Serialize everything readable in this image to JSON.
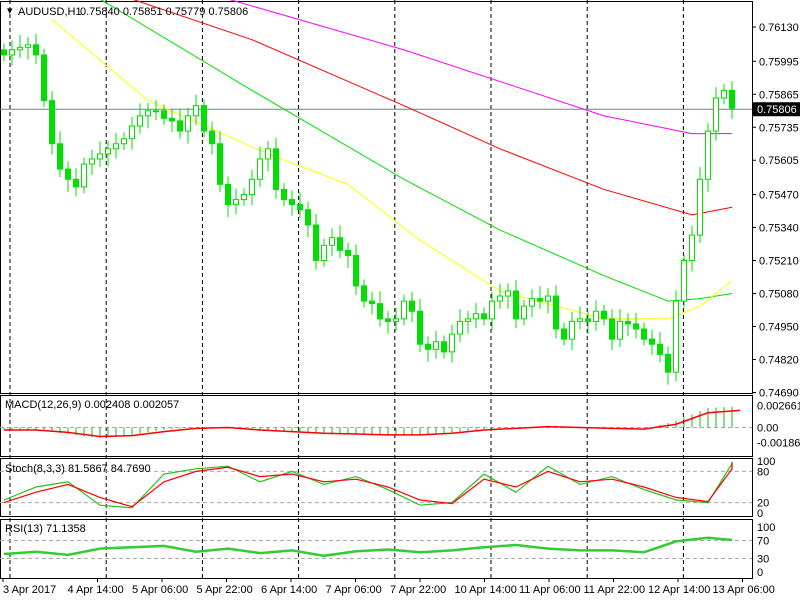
{
  "header": {
    "symbol": "AUDUSD,H1",
    "ohlc_text": "0.75840 0.75851 0.75779 0.75806"
  },
  "colors": {
    "bull": "#00e000",
    "bear": "#00e000",
    "ma1": "#ff00ff",
    "ma2": "#ff0000",
    "ma3": "#00e000",
    "ma4": "#ffff00",
    "grid": "#000000",
    "current": "#708090"
  },
  "chart_data": [
    {
      "type": "candlestick",
      "title": "AUDUSD,H1",
      "price_axis_ticks": [
        "0.76130",
        "0.75995",
        "0.75865",
        "0.75735",
        "0.75605",
        "0.75470",
        "0.75340",
        "0.75210",
        "0.75080",
        "0.74950",
        "0.74820",
        "0.74690"
      ],
      "ylim": [
        0.7469,
        0.7613
      ],
      "current_price": "0.75806",
      "closes": [
        0.7602,
        0.7604,
        0.7605,
        0.7606,
        0.7602,
        0.7584,
        0.7567,
        0.7557,
        0.7553,
        0.755,
        0.7559,
        0.7561,
        0.7563,
        0.7565,
        0.7567,
        0.7569,
        0.7574,
        0.7578,
        0.758,
        0.758,
        0.7577,
        0.7576,
        0.7572,
        0.7578,
        0.7582,
        0.7572,
        0.7567,
        0.7551,
        0.7543,
        0.7545,
        0.7547,
        0.7553,
        0.7561,
        0.7565,
        0.7549,
        0.7545,
        0.7543,
        0.7541,
        0.7535,
        0.7521,
        0.7527,
        0.753,
        0.7525,
        0.7523,
        0.7511,
        0.7505,
        0.7504,
        0.7498,
        0.7497,
        0.7498,
        0.7505,
        0.7501,
        0.7488,
        0.7486,
        0.7489,
        0.7485,
        0.7492,
        0.7497,
        0.7498,
        0.75,
        0.7498,
        0.7505,
        0.7507,
        0.7509,
        0.7498,
        0.7503,
        0.7506,
        0.7505,
        0.7507,
        0.7494,
        0.749,
        0.7497,
        0.7498,
        0.7497,
        0.7501,
        0.7498,
        0.749,
        0.7497,
        0.7496,
        0.7494,
        0.749,
        0.7488,
        0.7484,
        0.7477,
        0.7505,
        0.7521,
        0.7531,
        0.7553,
        0.7572,
        0.7585,
        0.7588,
        0.7581
      ],
      "moving_averages": [
        {
          "color": "#ff00ff",
          "points": [
            [
              28,
              0.7624
            ],
            [
              50,
              0.7604
            ],
            [
              75,
              0.7578
            ],
            [
              86,
              0.7571
            ],
            [
              91,
              0.7571
            ]
          ]
        },
        {
          "color": "#ff0000",
          "points": [
            [
              16,
              0.7624
            ],
            [
              31,
              0.7608
            ],
            [
              50,
              0.7582
            ],
            [
              62,
              0.7565
            ],
            [
              75,
              0.7549
            ],
            [
              86,
              0.7539
            ],
            [
              91,
              0.7542
            ]
          ]
        },
        {
          "color": "#00e000",
          "points": [
            [
              12,
              0.7624
            ],
            [
              31,
              0.7588
            ],
            [
              50,
              0.7553
            ],
            [
              62,
              0.7533
            ],
            [
              75,
              0.7515
            ],
            [
              83,
              0.7505
            ],
            [
              87,
              0.7506
            ],
            [
              91,
              0.7508
            ]
          ]
        },
        {
          "color": "#ffff00",
          "points": [
            [
              6,
              0.7616
            ],
            [
              18,
              0.7584
            ],
            [
              33,
              0.7563
            ],
            [
              43,
              0.7551
            ],
            [
              52,
              0.7529
            ],
            [
              62,
              0.7509
            ],
            [
              75,
              0.7498
            ],
            [
              83,
              0.7498
            ],
            [
              87,
              0.7503
            ],
            [
              91,
              0.7513
            ]
          ]
        }
      ],
      "time_labels": [
        "3 Apr 2017",
        "4 Apr 14:00",
        "5 Apr 06:00",
        "5 Apr 22:00",
        "6 Apr 14:00",
        "7 Apr 06:00",
        "7 Apr 22:00",
        "10 Apr 14:00",
        "11 Apr 06:00",
        "11 Apr 22:00",
        "12 Apr 14:00",
        "13 Apr 06:00"
      ]
    },
    {
      "type": "bar",
      "title": "MACD(12,26,9) 0.002408 0.002057",
      "ticks": [
        "0.002661",
        "0.00",
        "-0.001862"
      ],
      "sample_step": 4,
      "histogram": [
        -0.0002,
        -0.0003,
        -0.0008,
        -0.0013,
        -0.0009,
        -0.0003,
        0.0,
        0.0,
        -0.0004,
        -0.0006,
        -0.0008,
        -0.0009,
        -0.001,
        -0.001,
        -0.0006,
        -0.0002,
        0.0,
        0.0001,
        -0.0001,
        -0.0001,
        -0.0002,
        0.0008,
        0.0024,
        0.0026
      ],
      "signal": [
        -0.0003,
        -0.0003,
        -0.0006,
        -0.0011,
        -0.001,
        -0.0005,
        -0.0001,
        0.0,
        -0.0003,
        -0.0005,
        -0.0007,
        -0.0008,
        -0.0009,
        -0.0009,
        -0.0007,
        -0.0003,
        -0.0001,
        0.0001,
        0.0,
        -0.0001,
        -0.0002,
        0.0004,
        0.0018,
        0.0021
      ]
    },
    {
      "type": "line",
      "title": "Stoch(8,3,3) 81.5867 84.7690",
      "ticks": [
        "100",
        "80",
        "20",
        "0"
      ],
      "sample_step": 4,
      "k": [
        25,
        50,
        60,
        15,
        10,
        75,
        85,
        90,
        60,
        80,
        55,
        70,
        45,
        15,
        20,
        75,
        40,
        90,
        55,
        70,
        45,
        25,
        20,
        95,
        98,
        82
      ],
      "d": [
        20,
        40,
        55,
        30,
        12,
        60,
        80,
        88,
        70,
        75,
        60,
        65,
        50,
        25,
        18,
        65,
        50,
        80,
        60,
        65,
        50,
        30,
        22,
        85,
        98,
        85
      ]
    },
    {
      "type": "line",
      "title": "RSI(13) 71.1358",
      "ticks": [
        "100",
        "70",
        "30",
        "0"
      ],
      "sample_step": 4,
      "values": [
        40,
        45,
        38,
        52,
        55,
        58,
        45,
        52,
        42,
        48,
        36,
        46,
        50,
        44,
        48,
        55,
        60,
        52,
        48,
        48,
        44,
        68,
        76,
        71
      ]
    }
  ]
}
